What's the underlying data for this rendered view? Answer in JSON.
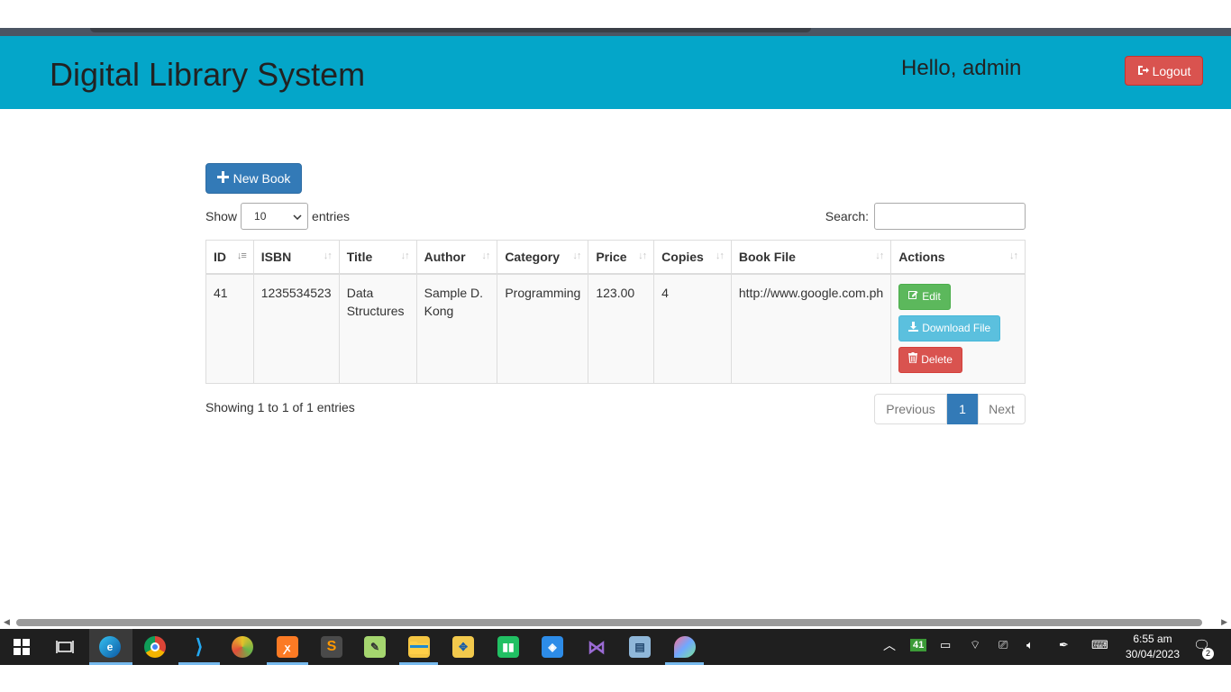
{
  "navbar": {
    "brand": "Digital Library System",
    "greeting": "Hello, admin",
    "logout_label": "Logout"
  },
  "toolbar": {
    "new_book_label": "New Book"
  },
  "table_controls": {
    "show_label": "Show",
    "entries_label": "entries",
    "page_length": "10",
    "search_label": "Search:",
    "search_value": ""
  },
  "table": {
    "columns": [
      "ID",
      "ISBN",
      "Title",
      "Author",
      "Category",
      "Price",
      "Copies",
      "Book File",
      "Actions"
    ],
    "sorted_column": "ID",
    "rows": [
      {
        "id": "41",
        "isbn": "1235534523",
        "title": "Data Structures",
        "author": "Sample D. Kong",
        "category": "Programming",
        "price": "123.00",
        "copies": "4",
        "book_file": "http://www.google.com.ph",
        "actions": {
          "edit": "Edit",
          "download": "Download File",
          "delete": "Delete"
        }
      }
    ]
  },
  "footer": {
    "info": "Showing 1 to 1 of 1 entries",
    "pagination": {
      "previous": "Previous",
      "current_page": "1",
      "next": "Next"
    }
  },
  "taskbar": {
    "apps": [
      "windows-start",
      "task-view",
      "edge",
      "chrome",
      "vscode",
      "app-green-swirl",
      "xampp",
      "sublime-text",
      "notepad-plus",
      "app-paint",
      "app-green-square",
      "app-blue-cube",
      "visual-studio",
      "app-notepad",
      "app-maps"
    ],
    "tray_badge": "41",
    "time": "6:55 am",
    "date": "30/04/2023",
    "notification_count": "2"
  },
  "colors": {
    "navbar": "#04a6c9",
    "primary": "#337ab7",
    "success": "#5cb85c",
    "info": "#5bc0de",
    "danger": "#d9534f"
  }
}
